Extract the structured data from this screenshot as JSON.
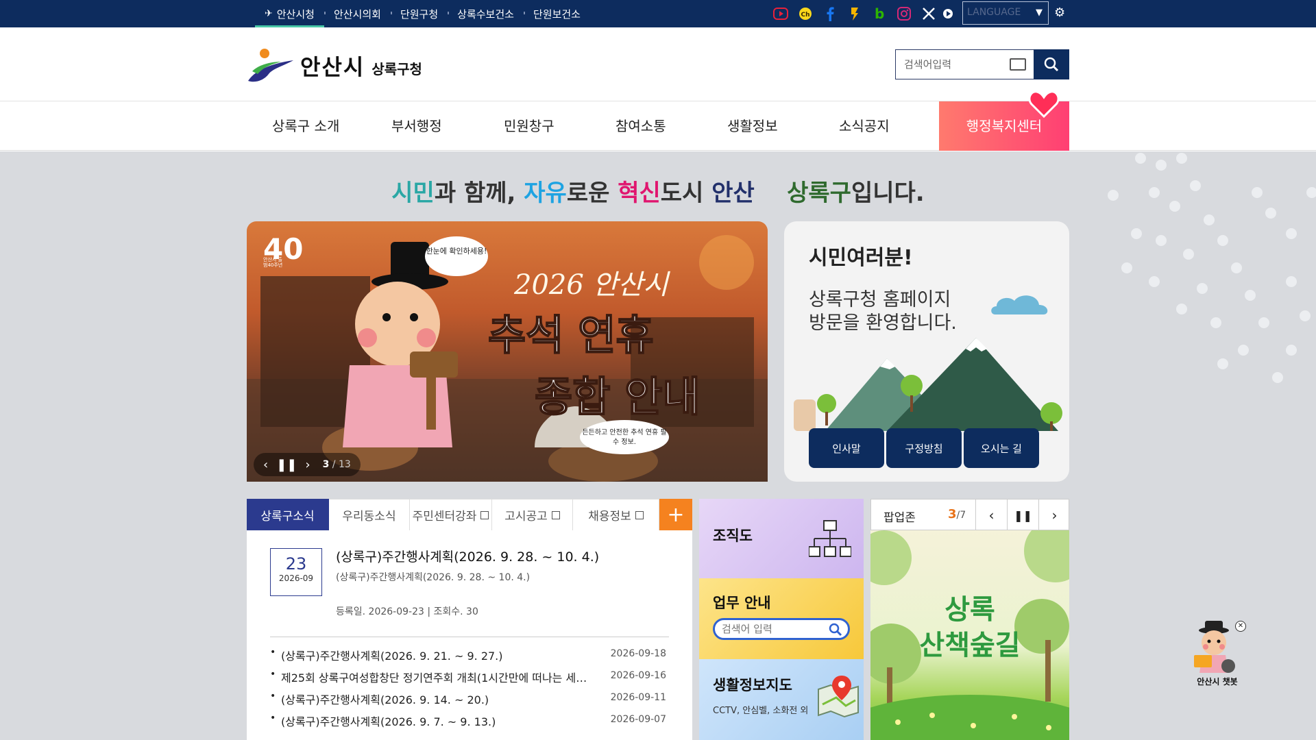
{
  "topbar": {
    "links": [
      "안산시청",
      "안산시의회",
      "단원구청",
      "상록수보건소",
      "단원보건소"
    ],
    "social_icons": [
      "youtube-icon",
      "kakao-channel-icon",
      "facebook-icon",
      "kakaostory-icon",
      "blog-icon",
      "instagram-icon",
      "x-icon",
      "play-icon"
    ],
    "language_label": "LANGUAGE"
  },
  "header": {
    "logo_text": "안산시",
    "logo_sub": "상록구청",
    "search_placeholder": "검색어입력"
  },
  "gnb": {
    "items": [
      "상록구 소개",
      "부서행정",
      "민원창구",
      "참여소통",
      "생활정보",
      "소식공지"
    ],
    "welfare": "행정복지센터"
  },
  "slogan": {
    "p1": "시민",
    "p2": "과 함께, ",
    "p3": "자유",
    "p4": "로운 ",
    "p5": "혁신",
    "p6": "도시 ",
    "p7": "안산",
    "p8": "상록구",
    "p9": "입니다."
  },
  "banner": {
    "title_line1": "2026 안산시",
    "title_line2": "추석 연휴",
    "title_line3": "종합 안내",
    "bubble1": "한눈에 확인하세용!",
    "bubble2": "든든하고 안전한 추석 연휴 필수 정보.",
    "badge": "40",
    "badge_sub": "안산시 출범40주년",
    "current": "3",
    "total": "/ 13"
  },
  "greeting": {
    "title": "시민여러분!",
    "line1": "상록구청 홈페이지",
    "line2": "방문을 환영합니다.",
    "buttons": [
      "인사말",
      "구정방침",
      "오시는 길"
    ]
  },
  "news": {
    "tabs": [
      "상록구소식",
      "우리동소식",
      "주민센터강좌",
      "고시공고",
      "채용정보"
    ],
    "featured": {
      "day": "23",
      "month": "2026-09",
      "title": "(상록구)주간행사계획(2026. 9. 28. ~ 10. 4.)",
      "subtitle": "(상록구)주간행사계획(2026. 9. 28. ~ 10. 4.)",
      "meta": "등록일. 2026-09-23  |  조회수. 30"
    },
    "list": [
      {
        "title": "(상록구)주간행사계획(2026. 9. 21. ~ 9. 27.)",
        "date": "2026-09-18"
      },
      {
        "title": "제25회 상록구여성합창단 정기연주회 개최(1시간만에 떠나는 세계여…",
        "date": "2026-09-16"
      },
      {
        "title": "(상록구)주간행사계획(2026. 9. 14. ~ 20.)",
        "date": "2026-09-11"
      },
      {
        "title": "(상록구)주간행사계획(2026. 9. 7. ~ 9. 13.)",
        "date": "2026-09-07"
      }
    ]
  },
  "tiles": {
    "org": "조직도",
    "work": "업무 안내",
    "work_placeholder": "검색어 입력",
    "map": "생활정보지도",
    "map_sub": "CCTV, 안심벨, 소화전 외"
  },
  "popup": {
    "title": "팝업존",
    "current": "3",
    "total": "/7",
    "image_text1": "상록",
    "image_text2": "산책숲길"
  },
  "chatbot": {
    "label": "안산시 챗봇"
  },
  "colors": {
    "navy": "#0d2c5e",
    "tab_active": "#2b3a8e",
    "orange": "#f5821f",
    "welfare_pink": "#ff3f73"
  }
}
